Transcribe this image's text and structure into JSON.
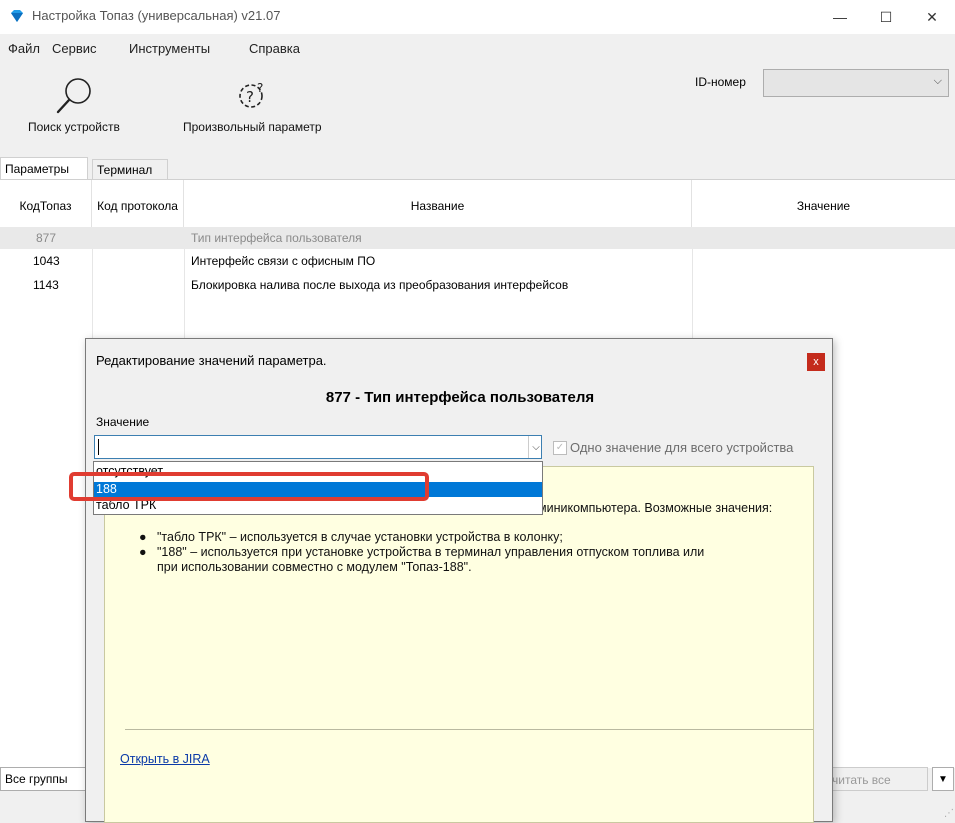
{
  "window": {
    "title": "Настройка Топаз (универсальная) v21.07",
    "controls": {
      "minimize": "—",
      "maximize": "☐",
      "close": "✕"
    }
  },
  "menu": [
    "Файл",
    "Сервис",
    "Инструменты",
    "Справка"
  ],
  "toolbar": {
    "search_label": "Поиск устройств",
    "param_label": "Произвольный параметр",
    "id_label": "ID-номер",
    "id_value": ""
  },
  "tabs": [
    {
      "label": "Параметры",
      "active": true
    },
    {
      "label": "Терминал",
      "active": false
    }
  ],
  "table": {
    "columns": [
      "КодТопаз",
      "Код протокола",
      "Название",
      "Значение"
    ],
    "rows": [
      {
        "kod": "877",
        "proto": "",
        "name": "Тип интерфейса пользователя",
        "value": "",
        "state": "selected"
      },
      {
        "kod": "1043",
        "proto": "",
        "name": "Интерфейс связи с офисным ПО",
        "value": ""
      },
      {
        "kod": "1143",
        "proto": "",
        "name": "Блокировка налива после выхода из преобразования интерфейсов",
        "value": ""
      }
    ]
  },
  "bottom": {
    "groups_label": "Все группы",
    "read_all_label": "читать все",
    "read_arrow": "▼"
  },
  "dialog": {
    "title": "Редактирование значений параметра.",
    "close": "x",
    "heading": "877 - Тип интерфейса пользователя",
    "value_label": "Значение",
    "input_value": "",
    "combo_arrow": "⌵",
    "checkbox_checked": true,
    "checkbox_label": "Одно значение для всего устройства",
    "desc_line1_tail": "миникомпьютера. Возможные значения:",
    "bullets": [
      "\"табло ТРК\" – используется в случае установки устройства в колонку;",
      "\"188\" – используется при установке устройства в терминал управления отпуском топлива или",
      "при использовании совместно с модулем \"Топаз-188\"."
    ],
    "jira_link": "Открыть в JIRA"
  },
  "dropdown": {
    "options": [
      "отсутствует",
      "188",
      "табло ТРК"
    ],
    "selected_index": 1
  },
  "colors": {
    "accent": "#0078d7",
    "highlight": "#e03c31",
    "desc_bg": "#ffffe1",
    "close_red": "#c42b1c"
  },
  "icons": {
    "app": "diamond-icon",
    "search": "magnifier-icon",
    "param": "gear-question-icon"
  }
}
